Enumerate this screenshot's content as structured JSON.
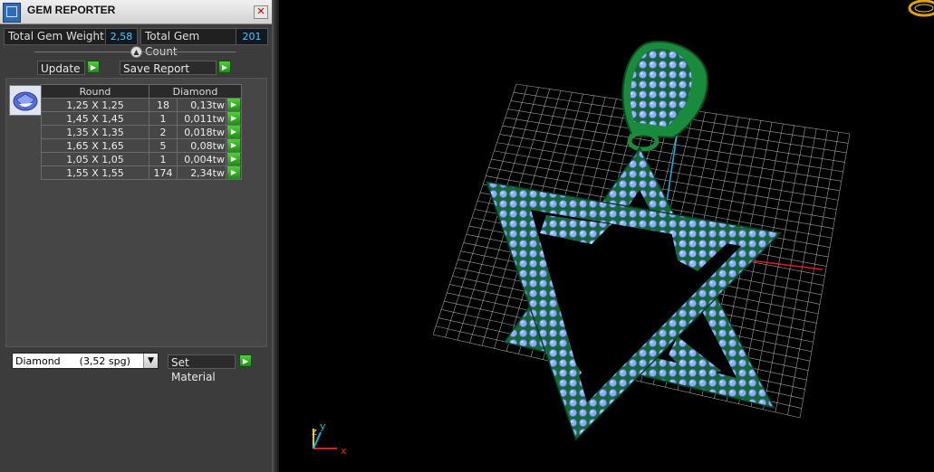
{
  "window": {
    "title": "GEM REPORTER"
  },
  "stats": {
    "total_weight_label": "Total Gem Weight",
    "total_weight_value": "2,58",
    "total_count_label": "Total Gem Count",
    "total_count_value": "201"
  },
  "actions": {
    "update_label": "Update",
    "save_report_label": "Save Report"
  },
  "table": {
    "headers": [
      "Round",
      "Diamond"
    ],
    "rows": [
      {
        "size": "1,25 X 1,25",
        "count": "18",
        "weight": "0,13tw"
      },
      {
        "size": "1,45 X 1,45",
        "count": "1",
        "weight": "0,011tw"
      },
      {
        "size": "1,35 X 1,35",
        "count": "2",
        "weight": "0,018tw"
      },
      {
        "size": "1,65 X 1,65",
        "count": "5",
        "weight": "0,08tw"
      },
      {
        "size": "1,05 X 1,05",
        "count": "1",
        "weight": "0,004tw"
      },
      {
        "size": "1,55 X 1,55",
        "count": "174",
        "weight": "2,34tw"
      }
    ]
  },
  "material": {
    "selected": "Diamond      (3,52 spg)",
    "set_label": "Set Material"
  },
  "viewport": {
    "axis_labels": {
      "x": "x",
      "y": "y",
      "z": "z"
    },
    "colors": {
      "metal": "#178a43",
      "gem": "#8fb4ff",
      "grid": "#c8c8c8",
      "x_axis": "#e02020",
      "y_axis": "#19b5d8"
    }
  }
}
